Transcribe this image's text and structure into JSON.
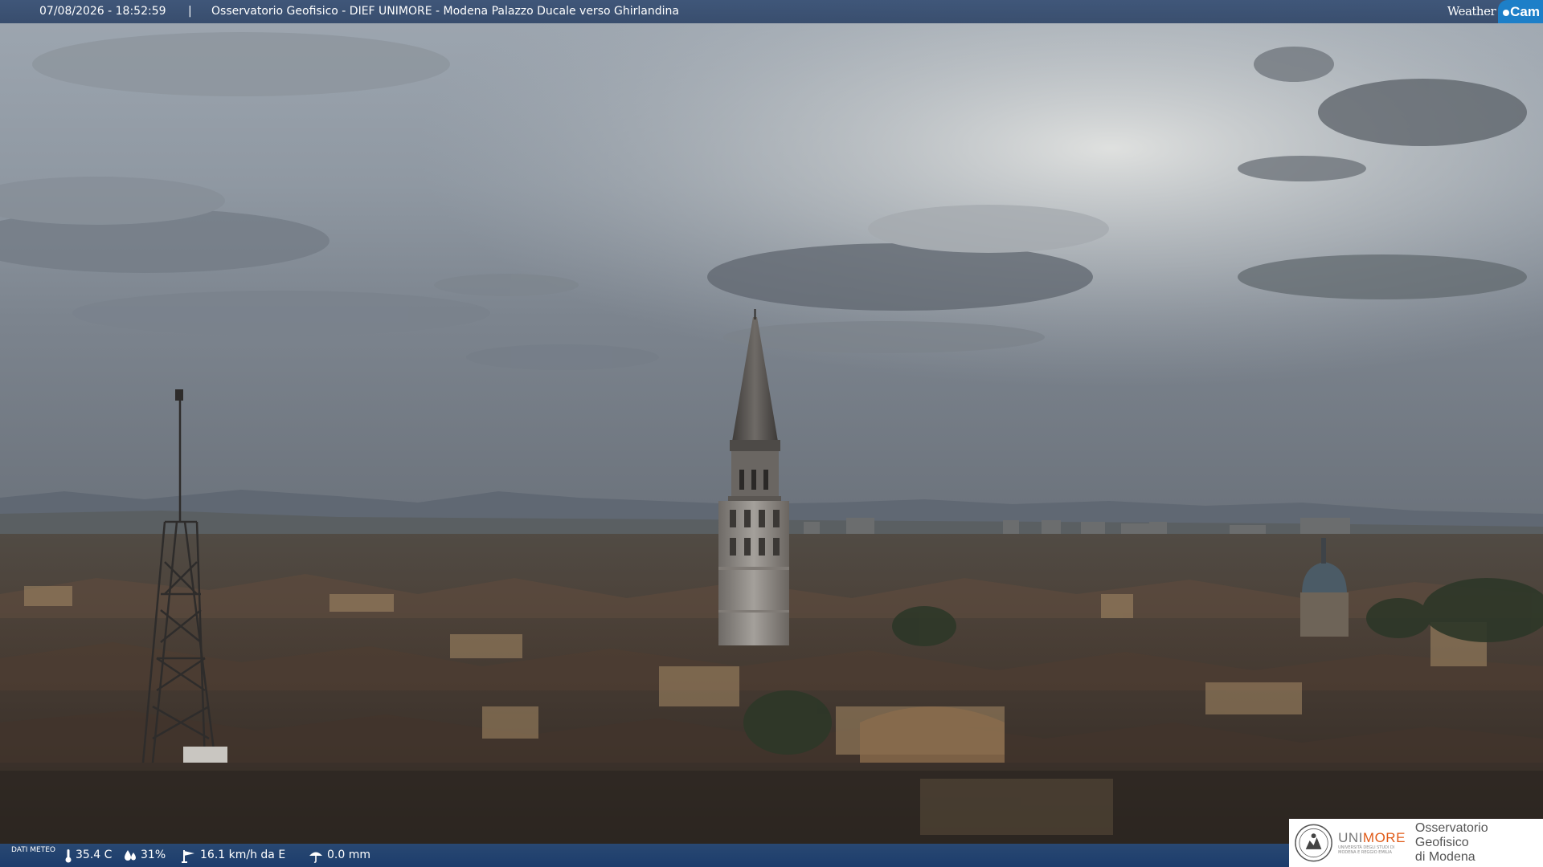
{
  "header": {
    "timestamp": "07/08/2026 - 18:52:59",
    "separator": "|",
    "title": "Osservatorio Geofisico - DIEF UNIMORE - Modena Palazzo Ducale verso Ghirlandina",
    "logo_weather": "Weather",
    "logo_cam": "Cam"
  },
  "weather": {
    "label": "DATI METEO",
    "temperature": "35.4 C",
    "humidity": "31%",
    "wind": "16.1 km/h da E",
    "rain": "0.0 mm",
    "icons": [
      "thermometer-icon",
      "humidity-drop-icon",
      "wind-icon",
      "rain-icon"
    ]
  },
  "logo": {
    "uni_part1": "UNI",
    "uni_part2": "MORE",
    "uni_small": "UNIVERSITÀ DEGLI STUDI DI MODENA E REGGIO EMILIA",
    "observatory_line1": "Osservatorio Geofisico",
    "observatory_line2": "di Modena"
  },
  "colors": {
    "banner": "#34507a",
    "cam_badge": "#1d7fc8",
    "unimore_orange": "#e05a17"
  }
}
